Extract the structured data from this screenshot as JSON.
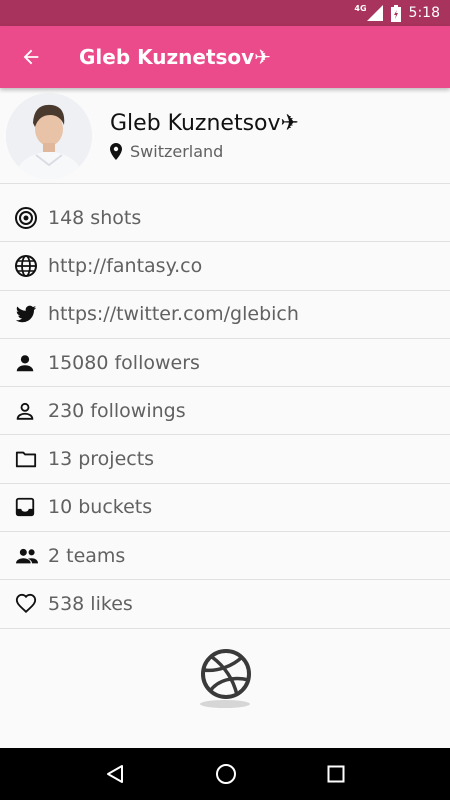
{
  "status_bar": {
    "network": "4G",
    "time": "5:18"
  },
  "app_bar": {
    "title": "Gleb Kuznetsov✈"
  },
  "profile": {
    "name": "Gleb Kuznetsov✈",
    "location": "Switzerland"
  },
  "stats": [
    {
      "icon": "target-icon",
      "text": "148 shots"
    },
    {
      "icon": "globe-icon",
      "text": "http://fantasy.co"
    },
    {
      "icon": "twitter-icon",
      "text": "https://twitter.com/glebich"
    },
    {
      "icon": "person-icon",
      "text": "15080 followers"
    },
    {
      "icon": "person-outline-icon",
      "text": "230 followings"
    },
    {
      "icon": "folder-icon",
      "text": "13 projects"
    },
    {
      "icon": "inbox-icon",
      "text": "10 buckets"
    },
    {
      "icon": "group-icon",
      "text": "2 teams"
    },
    {
      "icon": "heart-icon",
      "text": "538 likes"
    }
  ],
  "colors": {
    "status_bar": "#a8335c",
    "app_bar": "#ec4b8b",
    "text_secondary": "#616161"
  }
}
